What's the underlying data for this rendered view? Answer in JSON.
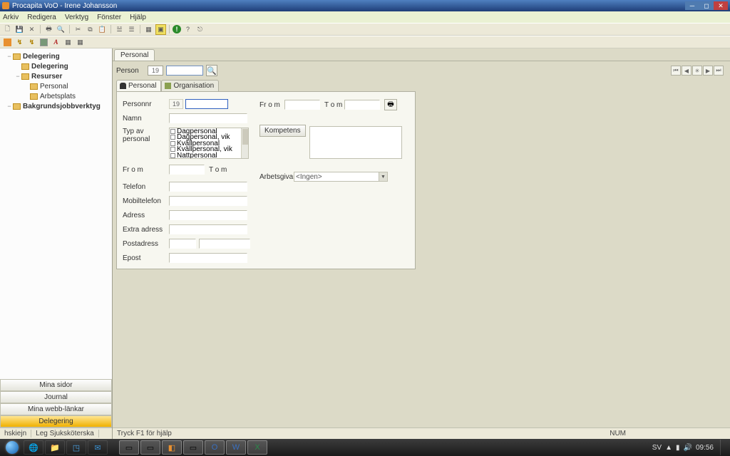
{
  "window": {
    "title": "Procapita VoO - Irene Johansson"
  },
  "menu": {
    "items": [
      "Arkiv",
      "Redigera",
      "Verktyg",
      "Fönster",
      "Hjälp"
    ]
  },
  "tree": {
    "root": "Delegering",
    "n1": "Delegering",
    "n2": "Resurser",
    "n2a": "Personal",
    "n2b": "Arbetsplats",
    "n3": "Bakgrundsjobbverktyg"
  },
  "side_buttons": {
    "b1": "Mina sidor",
    "b2": "Journal",
    "b3": "Mina webb-länkar",
    "b4": "Delegering"
  },
  "status_left": {
    "c1": "hskiejn",
    "c2": "Leg Sjuksköterska"
  },
  "doc_tab": "Personal",
  "person_row": {
    "label": "Person",
    "prefix": "19"
  },
  "subtabs": {
    "personal": "Personal",
    "organisation": "Organisation"
  },
  "form": {
    "personnr": "Personnr",
    "personnr_prefix": "19",
    "namn": "Namn",
    "typ": "Typ av personal",
    "typ_options": [
      "Dagpersonal",
      "Dagpersonal, vik",
      "Kvällpersonal",
      "Kvällpersonal, vik",
      "Nattpersonal"
    ],
    "from": "Fr o m",
    "tom": "T o m",
    "telefon": "Telefon",
    "mobiltelefon": "Mobiltelefon",
    "adress": "Adress",
    "extraadress": "Extra adress",
    "postadress": "Postadress",
    "epost": "Epost",
    "from2": "Fr o m",
    "tom2": "T o m",
    "kompetens_btn": "Kompetens",
    "arbetsgivare": "Arbetsgivare",
    "arbetsgivare_value": "<Ingen>"
  },
  "status_right": {
    "help": "Tryck F1 för hjälp",
    "num": "NUM"
  },
  "tray": {
    "lang": "SV",
    "time": "09:56"
  }
}
